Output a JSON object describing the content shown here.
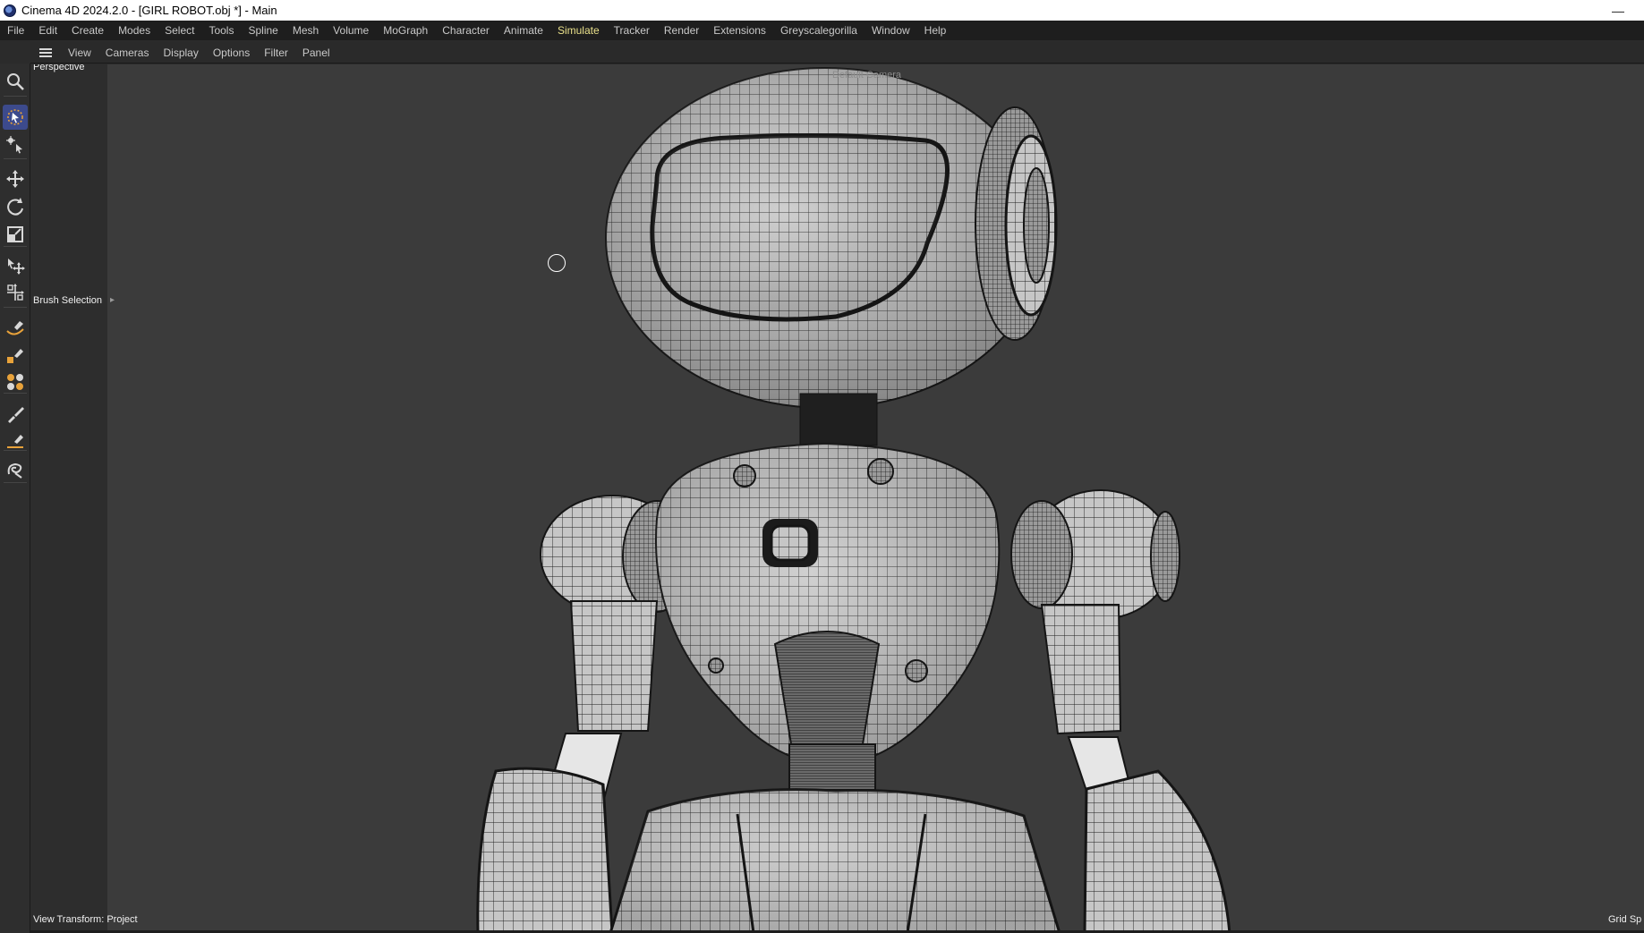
{
  "window": {
    "title": "Cinema 4D 2024.2.0 - [GIRL ROBOT.obj *] - Main",
    "minimize_glyph": "—"
  },
  "menubar": {
    "items": [
      "File",
      "Edit",
      "Create",
      "Modes",
      "Select",
      "Tools",
      "Spline",
      "Mesh",
      "Volume",
      "MoGraph",
      "Character",
      "Animate",
      "Simulate",
      "Tracker",
      "Render",
      "Extensions",
      "Greyscalegorilla",
      "Window",
      "Help"
    ],
    "active_item": "Simulate"
  },
  "viewport_menu": {
    "items": [
      "View",
      "Cameras",
      "Display",
      "Options",
      "Filter",
      "Panel"
    ]
  },
  "toolbar": {
    "tools": [
      {
        "name": "zoom-icon",
        "selected": false
      },
      {
        "name": "live-selection-icon",
        "selected": true
      },
      {
        "name": "tweak-icon",
        "selected": false
      },
      {
        "name": "move-icon",
        "selected": false
      },
      {
        "name": "rotate-icon",
        "selected": false
      },
      {
        "name": "scale-icon",
        "selected": false
      },
      {
        "name": "transfer-icon",
        "selected": false
      },
      {
        "name": "axis-move-icon",
        "selected": false
      },
      {
        "name": "spline-pen-icon",
        "selected": false
      },
      {
        "name": "sketch-icon",
        "selected": false
      },
      {
        "name": "mograph-icon",
        "selected": false
      },
      {
        "name": "paint-brush-icon",
        "selected": false
      },
      {
        "name": "knife-icon",
        "selected": false
      },
      {
        "name": "lasso-spline-icon",
        "selected": false
      }
    ]
  },
  "viewport": {
    "view_name": "Perspective",
    "camera": "Default Camera",
    "active_tool": "Brush Selection",
    "view_transform": "View Transform: Project",
    "grid_spacing": "Grid Sp",
    "accent_color": "#e9e08a",
    "selected_tool_color": "#3c4a8c"
  }
}
